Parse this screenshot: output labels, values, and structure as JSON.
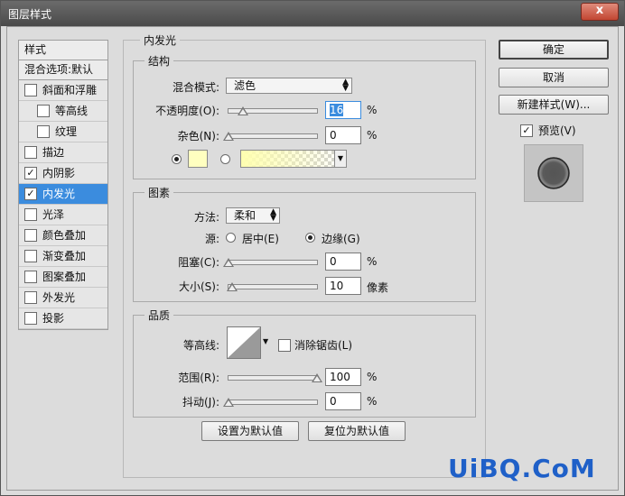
{
  "window": {
    "title": "图层样式",
    "close": "x"
  },
  "styles_panel": {
    "header": "样式",
    "blend_options": "混合选项:默认",
    "items": [
      {
        "label": "斜面和浮雕",
        "checked": false
      },
      {
        "label": "等高线",
        "checked": false,
        "sub": true
      },
      {
        "label": "纹理",
        "checked": false,
        "sub": true
      },
      {
        "label": "描边",
        "checked": false
      },
      {
        "label": "内阴影",
        "checked": true
      },
      {
        "label": "内发光",
        "checked": true,
        "active": true
      },
      {
        "label": "光泽",
        "checked": false
      },
      {
        "label": "颜色叠加",
        "checked": false
      },
      {
        "label": "渐变叠加",
        "checked": false
      },
      {
        "label": "图案叠加",
        "checked": false
      },
      {
        "label": "外发光",
        "checked": false
      },
      {
        "label": "投影",
        "checked": false
      }
    ]
  },
  "main": {
    "title": "内发光",
    "structure": {
      "title": "结构",
      "blend_mode_label": "混合模式:",
      "blend_mode_value": "滤色",
      "opacity_label": "不透明度(O):",
      "opacity_value": "16",
      "opacity_pct": 16,
      "noise_label": "杂色(N):",
      "noise_value": "0",
      "noise_pct": 0,
      "percent": "%",
      "color_hex": "#ffffc0"
    },
    "elements": {
      "title": "图素",
      "method_label": "方法:",
      "method_value": "柔和",
      "source_label": "源:",
      "source_center": "居中(E)",
      "source_edge": "边缘(G)",
      "choke_label": "阻塞(C):",
      "choke_value": "0",
      "choke_pct": 0,
      "size_label": "大小(S):",
      "size_value": "10",
      "size_pct": 4,
      "size_unit": "像素",
      "percent": "%"
    },
    "quality": {
      "title": "品质",
      "contour_label": "等高线:",
      "antialias_label": "消除锯齿(L)",
      "range_label": "范围(R):",
      "range_value": "100",
      "range_pct": 100,
      "jitter_label": "抖动(J):",
      "jitter_value": "0",
      "jitter_pct": 0,
      "percent": "%"
    },
    "set_default": "设置为默认值",
    "reset_default": "复位为默认值"
  },
  "actions": {
    "ok": "确定",
    "cancel": "取消",
    "new_style": "新建样式(W)...",
    "preview_label": "预览(V)",
    "preview_checked": true
  },
  "watermark": "UiBQ.CoM"
}
